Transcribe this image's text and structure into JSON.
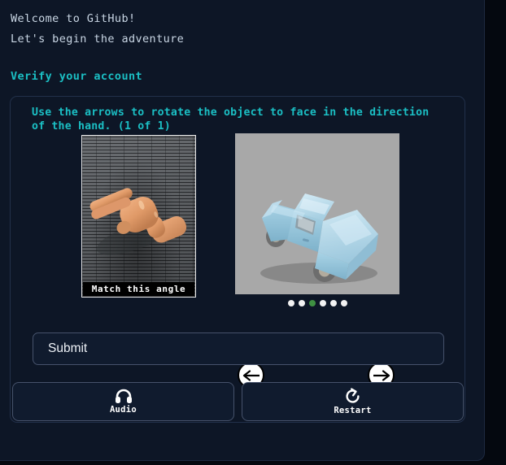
{
  "header": {
    "welcome_lines": [
      "Welcome to GitHub!",
      "Let's begin the adventure"
    ],
    "verify_title": "Verify your account"
  },
  "challenge": {
    "instruction": "Use the arrows to rotate the object to face in the direction of the hand. (1 of 1)",
    "reference": {
      "caption": "Match this angle",
      "subject": "wooden-hand-pointing",
      "direction": "upper-left"
    },
    "object": {
      "subject": "light-blue-pickup-truck",
      "background_color": "#a8a8a8",
      "body_color": "#a8d4e6"
    },
    "controls": {
      "rotate_left_icon": "arrow-left-icon",
      "rotate_right_icon": "arrow-right-icon"
    },
    "progress": {
      "total": 6,
      "active_index": 2,
      "active_color": "#3f9142",
      "inactive_color": "#f2f2f2"
    }
  },
  "submit": {
    "label": "Submit"
  },
  "actions": [
    {
      "label": "Audio",
      "icon": "headphones-icon"
    },
    {
      "label": "Restart",
      "icon": "restart-icon"
    }
  ],
  "colors": {
    "page_background": "#0d1626",
    "outer_background": "#04080f",
    "accent_teal": "#1bbfc4",
    "text_muted": "#c9d6e4",
    "border": "#46526b"
  }
}
